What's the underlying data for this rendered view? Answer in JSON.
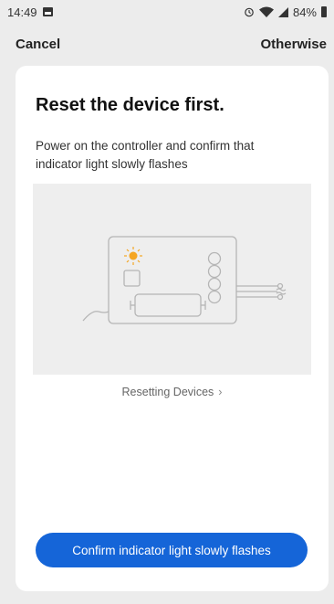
{
  "status": {
    "time": "14:49",
    "battery": "84%"
  },
  "nav": {
    "cancel_label": "Cancel",
    "otherwise_label": "Otherwise"
  },
  "card": {
    "title": "Reset the device first.",
    "description": "Power on the controller and confirm that indicator light slowly flashes",
    "reset_link": "Resetting Devices",
    "confirm_label": "Confirm indicator light slowly flashes"
  },
  "colors": {
    "accent": "#1565d8",
    "indicator_light": "#f5a623"
  },
  "icons": [
    "image-notification-icon",
    "alarm-icon",
    "wifi-icon",
    "signal-icon",
    "battery-icon",
    "chevron-right-icon",
    "indicator-light-icon"
  ]
}
